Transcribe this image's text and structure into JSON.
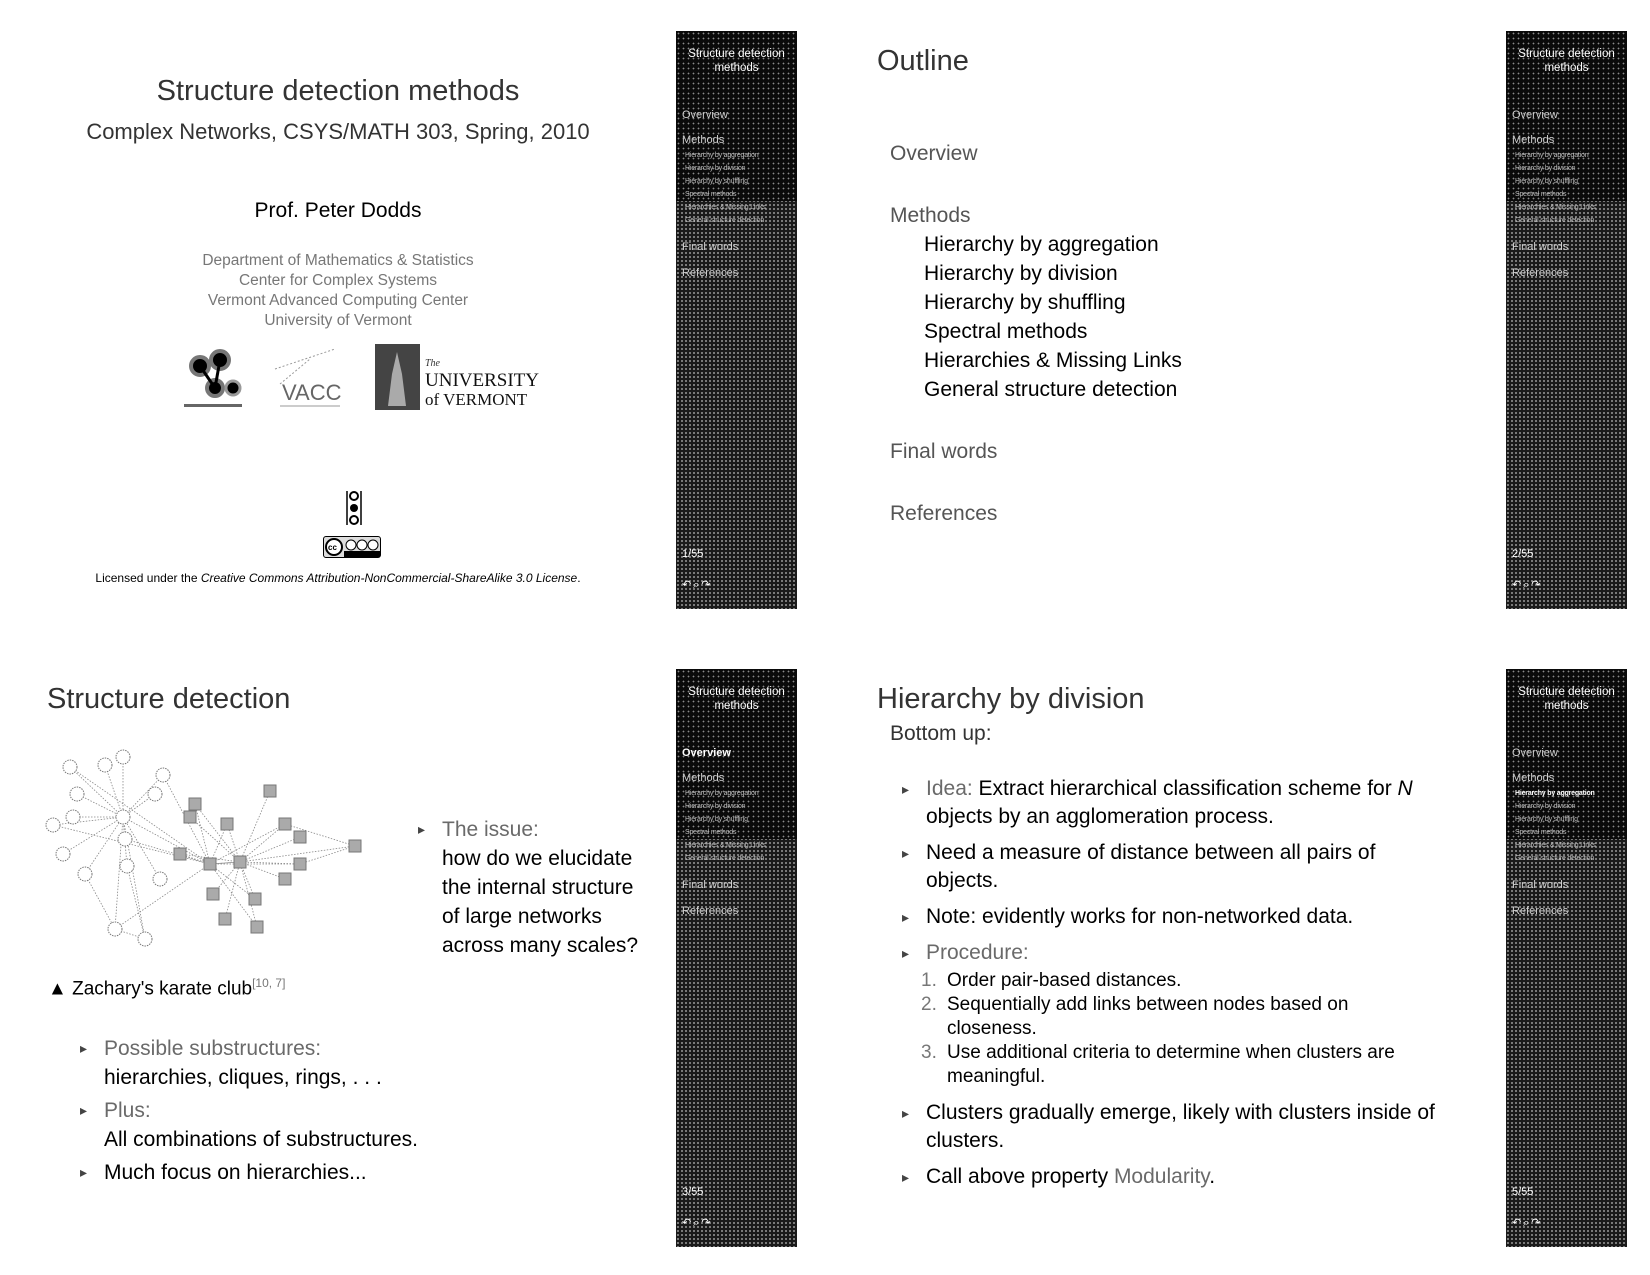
{
  "sidebar": {
    "title": "Structure detection methods",
    "sections": [
      "Overview",
      "Methods"
    ],
    "subsections": [
      "Hierarchy by aggregation",
      "Hierarchy by division",
      "Hierarchy by shuffling",
      "Spectral methods",
      "Hierarchies & Missing Links",
      "General structure detection"
    ],
    "final_sections": [
      "Final words",
      "References"
    ],
    "nav_icons": [
      "back-icon",
      "search-icon",
      "forward-icon"
    ]
  },
  "slides": [
    {
      "page": "1/55",
      "title": "Structure detection methods",
      "subtitle": "Complex Networks, CSYS/MATH 303, Spring, 2010",
      "author": "Prof. Peter Dodds",
      "affiliations": [
        "Department of Mathematics & Statistics",
        "Center for Complex Systems",
        "Vermont Advanced Computing Center",
        "University of Vermont"
      ],
      "logos": [
        "Complex Systems Center",
        "VACC",
        "The University of Vermont"
      ],
      "vacc_label": "VACC",
      "uvm_the": "The",
      "uvm_line1": "UNIVERSITY",
      "uvm_line2": "of VERMONT",
      "cc_label": "cc by-nc-sa",
      "license_prefix": "Licensed under the ",
      "license_name": "Creative Commons Attribution-NonCommercial-ShareAlike 3.0 License",
      "license_suffix": "."
    },
    {
      "page": "2/55",
      "title": "Outline",
      "outline": {
        "overview": "Overview",
        "methods": "Methods",
        "subsections": [
          "Hierarchy by aggregation",
          "Hierarchy by division",
          "Hierarchy by shuffling",
          "Spectral methods",
          "Hierarchies & Missing Links",
          "General structure detection"
        ],
        "final_words": "Final words",
        "references": "References"
      }
    },
    {
      "page": "3/55",
      "title": "Structure detection",
      "caption_marker": "▲",
      "caption": "Zachary's karate club",
      "caption_refs": "[10, 7]",
      "issue_label": "The issue:",
      "issue_text": "how do we elucidate the internal structure of large networks across many scales?",
      "bullets": [
        {
          "label": "Possible substructures:",
          "text": "hierarchies, cliques, rings, . . ."
        },
        {
          "label": "Plus:",
          "text": "All combinations of substructures."
        },
        {
          "label": "",
          "text": "Much focus on hierarchies..."
        }
      ]
    },
    {
      "page": "5/55",
      "title": "Hierarchy by division",
      "intro": "Bottom up:",
      "bullet1_label": "Idea:",
      "bullet1_text": " Extract hierarchical classification scheme for ",
      "bullet1_var": "N",
      "bullet1_tail": " objects by an agglomeration process.",
      "bullet2": "Need a measure of distance between all pairs of objects.",
      "bullet3": "Note: evidently works for non-networked data.",
      "bullet4_label": "Procedure:",
      "steps": [
        {
          "num": "1.",
          "text": "Order pair-based distances."
        },
        {
          "num": "2.",
          "text": "Sequentially add links between nodes based on closeness."
        },
        {
          "num": "3.",
          "text": "Use additional criteria to determine when clusters are meaningful."
        }
      ],
      "bullet5": "Clusters gradually emerge, likely with clusters inside of clusters.",
      "bullet6_text": "Call above property ",
      "bullet6_term": "Modularity",
      "bullet6_tail": "."
    }
  ],
  "highlights": {
    "slide3_section": "Overview",
    "slide4_subsection": "Hierarchy by aggregation"
  }
}
